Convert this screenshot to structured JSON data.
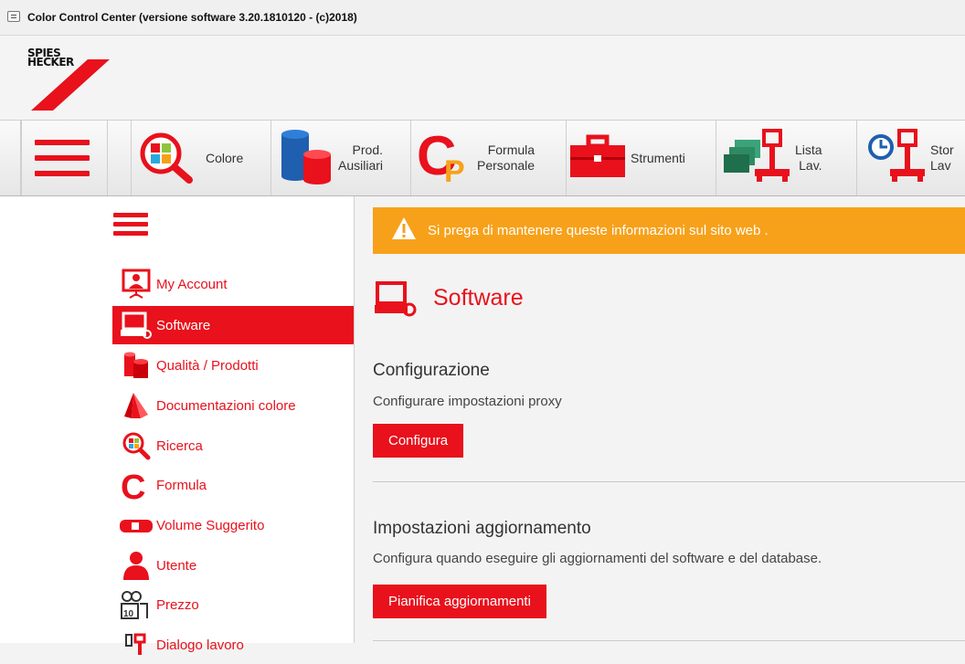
{
  "window": {
    "title": "Color Control Center (versione software 3.20.1810120 - (c)2018)"
  },
  "brand": {
    "logo_line1": "SPIES",
    "logo_line2": "HECKER",
    "accent": "#e8111c",
    "warning": "#f7a11a"
  },
  "toolbar": {
    "items": [
      {
        "label": "Colore",
        "icon": "color-search-icon"
      },
      {
        "label": "Prod.\nAusiliari",
        "icon": "cans-icon"
      },
      {
        "label": "Formula\nPersonale",
        "icon": "cp-icon"
      },
      {
        "label": "Strumenti",
        "icon": "toolbox-icon"
      },
      {
        "label": "Lista\nLav.",
        "icon": "scale-list-icon"
      },
      {
        "label": "Stor\nLav",
        "icon": "history-scale-icon"
      }
    ]
  },
  "sidebar": {
    "items": [
      {
        "label": "My Account",
        "icon": "account-icon"
      },
      {
        "label": "Software",
        "icon": "software-icon",
        "active": true
      },
      {
        "label": "Qualità / Prodotti",
        "icon": "products-icon"
      },
      {
        "label": "Documentazioni colore",
        "icon": "color-fan-icon"
      },
      {
        "label": "Ricerca",
        "icon": "search-icon"
      },
      {
        "label": "Formula",
        "icon": "formula-icon"
      },
      {
        "label": "Volume Suggerito",
        "icon": "volume-icon"
      },
      {
        "label": "Utente",
        "icon": "user-icon"
      },
      {
        "label": "Prezzo",
        "icon": "price-icon"
      },
      {
        "label": "Dialogo lavoro",
        "icon": "dialog-icon"
      }
    ]
  },
  "main": {
    "alert": "Si prega di mantenere queste informazioni sul sito web .",
    "title": "Software",
    "sections": [
      {
        "heading": "Configurazione",
        "description": "Configurare impostazioni proxy",
        "button": "Configura"
      },
      {
        "heading": "Impostazioni aggiornamento",
        "description": "Configura quando eseguire gli aggiornamenti del software e del database.",
        "button": "Pianifica aggiornamenti"
      }
    ]
  }
}
